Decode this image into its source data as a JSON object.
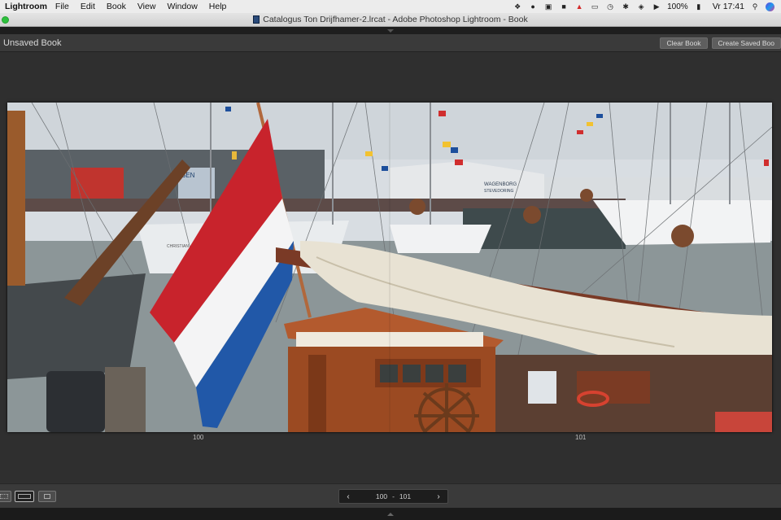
{
  "menubar": {
    "app_name": "Lightroom",
    "menus": [
      "File",
      "Edit",
      "Book",
      "View",
      "Window",
      "Help"
    ],
    "battery": "100%",
    "clock": "Vr 17:41"
  },
  "window": {
    "title": "Catalogus Ton Drijfhamer-2.lrcat - Adobe Photoshop Lightroom - Book"
  },
  "book": {
    "title": "Unsaved Book",
    "clear_label": "Clear Book",
    "create_label": "Create Saved Boo"
  },
  "spread": {
    "left_page": "100",
    "right_page": "101"
  },
  "photo_signs": {
    "wagenborg": "WAGENBORG",
    "stevedoring": "STEVEDORING",
    "sen": "SEN",
    "christian": "CHRISTIAN"
  },
  "pager": {
    "from": "100",
    "separator": "-",
    "to": "101"
  }
}
